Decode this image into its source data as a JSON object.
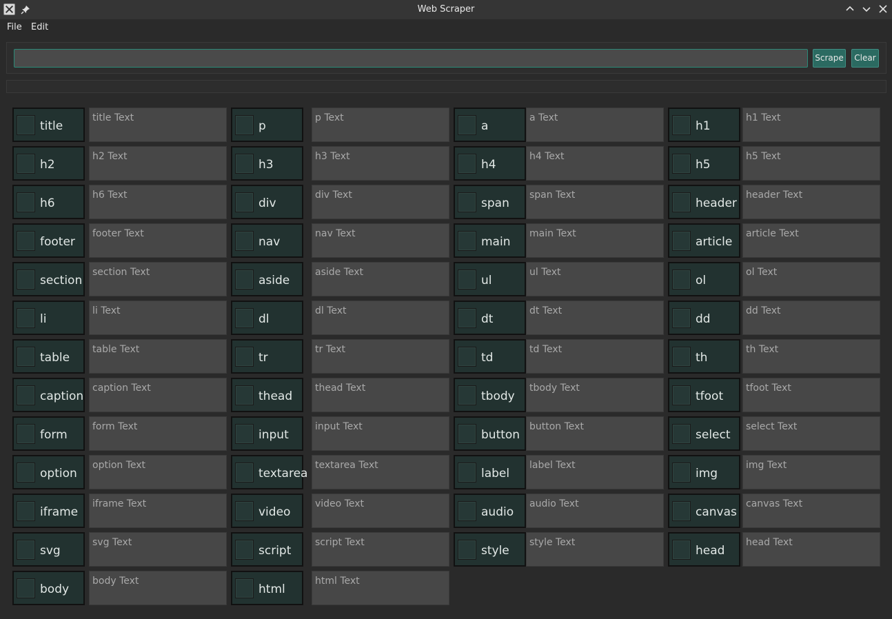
{
  "window": {
    "title": "Web Scraper",
    "app_icon": "x11-app-icon",
    "pin_icon": "pin-icon"
  },
  "menu": [
    "File",
    "Edit"
  ],
  "url_input": {
    "value": "",
    "placeholder": ""
  },
  "buttons": {
    "scrape": "Scrape",
    "clear": "Clear"
  },
  "colors": {
    "accent": "#2b6a61",
    "tag_bg": "#223230",
    "field_bg": "#474747",
    "window_bg": "#2a2a2a"
  },
  "tags": [
    {
      "label": "title",
      "text": "title Text"
    },
    {
      "label": "p",
      "text": "p Text"
    },
    {
      "label": "a",
      "text": "a Text"
    },
    {
      "label": "h1",
      "text": "h1 Text"
    },
    {
      "label": "h2",
      "text": "h2 Text"
    },
    {
      "label": "h3",
      "text": "h3 Text"
    },
    {
      "label": "h4",
      "text": "h4 Text"
    },
    {
      "label": "h5",
      "text": "h5 Text"
    },
    {
      "label": "h6",
      "text": "h6 Text"
    },
    {
      "label": "div",
      "text": "div Text"
    },
    {
      "label": "span",
      "text": "span Text"
    },
    {
      "label": "header",
      "text": "header Text"
    },
    {
      "label": "footer",
      "text": "footer Text"
    },
    {
      "label": "nav",
      "text": "nav Text"
    },
    {
      "label": "main",
      "text": "main Text"
    },
    {
      "label": "article",
      "text": "article Text"
    },
    {
      "label": "section",
      "text": "section Text"
    },
    {
      "label": "aside",
      "text": "aside Text"
    },
    {
      "label": "ul",
      "text": "ul Text"
    },
    {
      "label": "ol",
      "text": "ol Text"
    },
    {
      "label": "li",
      "text": "li Text"
    },
    {
      "label": "dl",
      "text": "dl Text"
    },
    {
      "label": "dt",
      "text": "dt Text"
    },
    {
      "label": "dd",
      "text": "dd Text"
    },
    {
      "label": "table",
      "text": "table Text"
    },
    {
      "label": "tr",
      "text": "tr Text"
    },
    {
      "label": "td",
      "text": "td Text"
    },
    {
      "label": "th",
      "text": "th Text"
    },
    {
      "label": "caption",
      "text": "caption Text"
    },
    {
      "label": "thead",
      "text": "thead Text"
    },
    {
      "label": "tbody",
      "text": "tbody Text"
    },
    {
      "label": "tfoot",
      "text": "tfoot Text"
    },
    {
      "label": "form",
      "text": "form Text"
    },
    {
      "label": "input",
      "text": "input Text"
    },
    {
      "label": "button",
      "text": "button Text"
    },
    {
      "label": "select",
      "text": "select Text"
    },
    {
      "label": "option",
      "text": "option Text"
    },
    {
      "label": "textarea",
      "text": "textarea Text"
    },
    {
      "label": "label",
      "text": "label Text"
    },
    {
      "label": "img",
      "text": "img Text"
    },
    {
      "label": "iframe",
      "text": "iframe Text"
    },
    {
      "label": "video",
      "text": "video Text"
    },
    {
      "label": "audio",
      "text": "audio Text"
    },
    {
      "label": "canvas",
      "text": "canvas Text"
    },
    {
      "label": "svg",
      "text": "svg Text"
    },
    {
      "label": "script",
      "text": "script Text"
    },
    {
      "label": "style",
      "text": "style Text"
    },
    {
      "label": "head",
      "text": "head Text"
    },
    {
      "label": "body",
      "text": "body Text"
    },
    {
      "label": "html",
      "text": "html Text"
    }
  ]
}
